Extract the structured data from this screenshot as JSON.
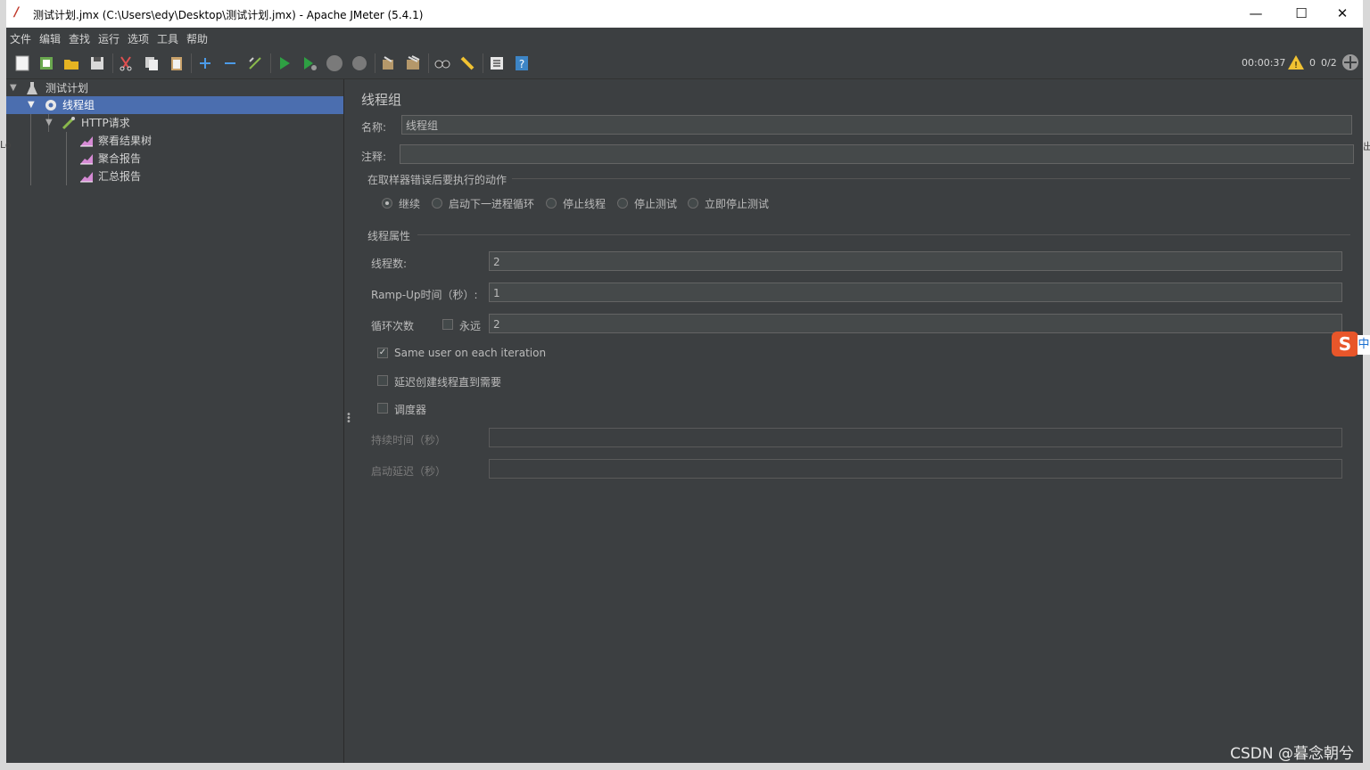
{
  "window": {
    "title": "测试计划.jmx (C:\\Users\\edy\\Desktop\\测试计划.jmx) - Apache JMeter (5.4.1)",
    "minimize": "—",
    "maximize": "☐",
    "close": "✕"
  },
  "menu": [
    "文件",
    "编辑",
    "查找",
    "运行",
    "选项",
    "工具",
    "帮助"
  ],
  "toolbar_icons": [
    "new-icon",
    "templates-icon",
    "open-icon",
    "save-icon",
    "cut-icon",
    "copy-icon",
    "paste-icon",
    "expand-icon",
    "collapse-icon",
    "toggle-icon",
    "start-icon",
    "start-no-pause-icon",
    "stop-icon",
    "shutdown-icon",
    "clear-icon",
    "clear-all-icon",
    "search-icon",
    "reset-search-icon",
    "function-helper-icon",
    "help-icon"
  ],
  "status": {
    "elapsed": "00:00:37",
    "warnings": "0",
    "threads": "0/2"
  },
  "tree": {
    "plan": "测试计划",
    "thread_group": "线程组",
    "http_request": "HTTP请求",
    "listeners": [
      "察看结果树",
      "聚合报告",
      "汇总报告"
    ]
  },
  "panel": {
    "heading": "线程组",
    "name_label": "名称:",
    "name_value": "线程组",
    "comment_label": "注释:",
    "comment_value": "",
    "error_section": "在取样器错误后要执行的动作",
    "actions": [
      "继续",
      "启动下一进程循环",
      "停止线程",
      "停止测试",
      "立即停止测试"
    ],
    "selected_action": "继续",
    "thread_props": "线程属性",
    "threads_label": "线程数:",
    "threads_value": "2",
    "rampup_label": "Ramp-Up时间（秒）:",
    "rampup_value": "1",
    "loop_label": "循环次数",
    "forever_label": "永远",
    "loop_value": "2",
    "same_user_label": "Same user on each iteration",
    "same_user_checked": true,
    "delay_label": "延迟创建线程直到需要",
    "scheduler_label": "调度器",
    "duration_label": "持续时间（秒）",
    "startup_delay_label": "启动延迟（秒）"
  },
  "watermark": "CSDN @暮念朝兮"
}
